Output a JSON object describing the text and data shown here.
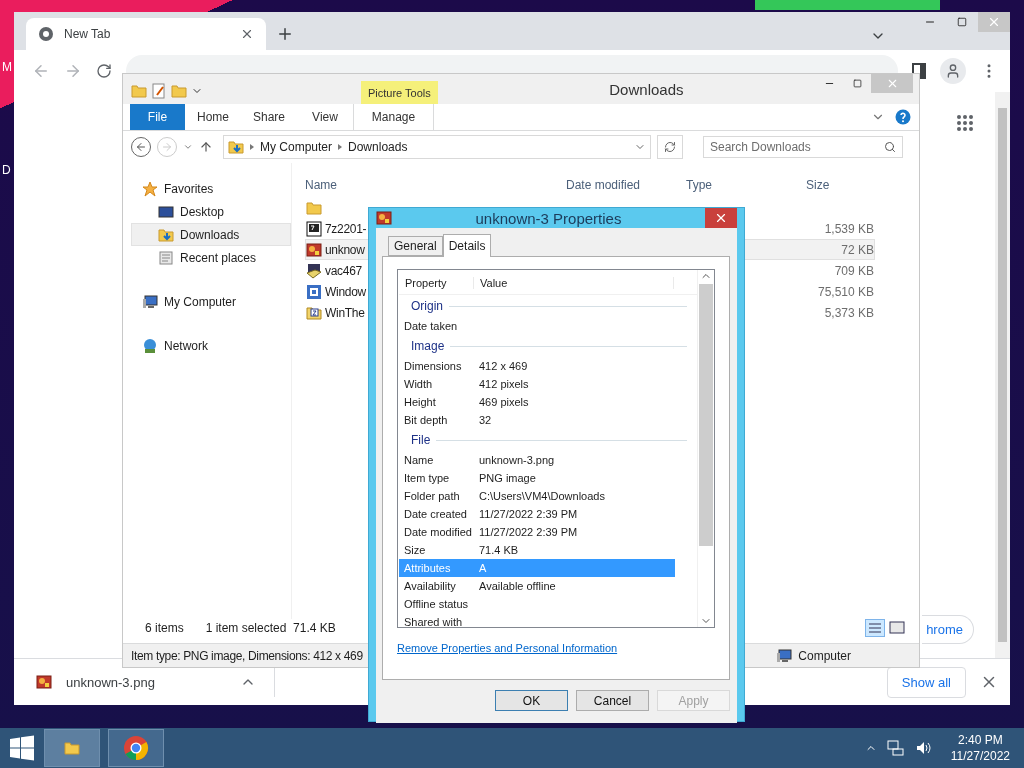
{
  "desktop": {
    "icon_labels": [
      "M",
      "D"
    ]
  },
  "chrome": {
    "tab": {
      "title": "New Tab",
      "selected": true
    },
    "customize_button": "hrome",
    "download": {
      "file": "unknown-3.png"
    },
    "show_all": "Show all"
  },
  "explorer": {
    "title": "Downloads",
    "context_tab": "Picture Tools",
    "ribbon_tabs": [
      {
        "label": "File",
        "kind": "file"
      },
      {
        "label": "Home",
        "kind": "tab"
      },
      {
        "label": "Share",
        "kind": "tab"
      },
      {
        "label": "View",
        "kind": "tab"
      },
      {
        "label": "Manage",
        "kind": "context"
      }
    ],
    "breadcrumb": [
      "My Computer",
      "Downloads"
    ],
    "search": {
      "placeholder": "Search Downloads"
    },
    "nav": [
      {
        "label": "Favorites",
        "kind": "star",
        "selected": false,
        "children": [
          {
            "label": "Desktop",
            "kind": "desktop",
            "selected": false
          },
          {
            "label": "Downloads",
            "kind": "download",
            "selected": true
          },
          {
            "label": "Recent places",
            "kind": "recent",
            "selected": false
          }
        ]
      },
      {
        "label": "My Computer",
        "kind": "computer",
        "selected": false
      },
      {
        "label": "Network",
        "kind": "network",
        "selected": false
      }
    ],
    "columns": [
      "Name",
      "Date modified",
      "Type",
      "Size"
    ],
    "files": [
      {
        "kind": "folder",
        "selected": false
      },
      {
        "kind": "archive",
        "name": "7z2201-",
        "size": "1,539 KB",
        "selected": false
      },
      {
        "kind": "image",
        "name": "unknow",
        "size": "72 KB",
        "selected": true
      },
      {
        "kind": "installer",
        "name": "vac467",
        "size": "709 KB",
        "selected": false
      },
      {
        "kind": "app",
        "name": "Window",
        "size": "75,510 KB",
        "selected": false
      },
      {
        "kind": "zip",
        "name": "WinThe",
        "size": "5,373 KB",
        "selected": false
      }
    ],
    "item_count": "6 items",
    "selection_info": "1 item selected  71.4 KB",
    "details": "Item type: PNG image, Dimensions: 412 x 469",
    "location": "Computer"
  },
  "dialog": {
    "title": "unknown-3 Properties",
    "tabs": [
      {
        "label": "General",
        "selected": false
      },
      {
        "label": "Details",
        "selected": true
      }
    ],
    "columns": [
      "Property",
      "Value"
    ],
    "groups": [
      {
        "heading": "Origin",
        "rows": [
          {
            "property": "Date taken",
            "selected": false
          }
        ]
      },
      {
        "heading": "Image",
        "rows": [
          {
            "property": "Dimensions",
            "value": "412 x 469",
            "selected": false
          },
          {
            "property": "Width",
            "value": "412 pixels",
            "selected": false
          },
          {
            "property": "Height",
            "value": "469 pixels",
            "selected": false
          },
          {
            "property": "Bit depth",
            "value": "32",
            "selected": false
          }
        ]
      },
      {
        "heading": "File",
        "rows": [
          {
            "property": "Name",
            "value": "unknown-3.png",
            "selected": false
          },
          {
            "property": "Item type",
            "value": "PNG image",
            "selected": false
          },
          {
            "property": "Folder path",
            "value": "C:\\Users\\VM4\\Downloads",
            "selected": false
          },
          {
            "property": "Date created",
            "value": "11/27/2022 2:39 PM",
            "selected": false
          },
          {
            "property": "Date modified",
            "value": "11/27/2022 2:39 PM",
            "selected": false
          },
          {
            "property": "Size",
            "value": "71.4 KB",
            "selected": false
          },
          {
            "property": "Attributes",
            "value": "A",
            "selected": true
          },
          {
            "property": "Availability",
            "value": "Available offline",
            "selected": false
          },
          {
            "property": "Offline status",
            "selected": false
          },
          {
            "property": "Shared with",
            "selected": false
          }
        ]
      }
    ],
    "link": "Remove Properties and Personal Information",
    "buttons": [
      {
        "label": "OK",
        "kind": "default",
        "disabled": false
      },
      {
        "label": "Cancel",
        "kind": "normal",
        "disabled": false
      },
      {
        "label": "Apply",
        "kind": "normal",
        "disabled": true
      }
    ]
  },
  "taskbar": {
    "time": "2:40 PM",
    "date": "11/27/2022"
  }
}
